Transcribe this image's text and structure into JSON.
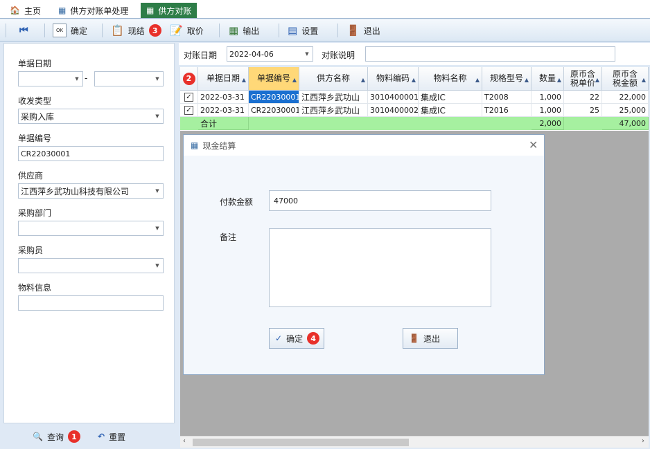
{
  "tabs": [
    {
      "label": "主页"
    },
    {
      "label": "供方对账单处理"
    },
    {
      "label": "供方对账"
    }
  ],
  "toolbar": {
    "confirm": "确定",
    "cash": "现结",
    "cash_badge": "3",
    "cancel_price": "取价",
    "export": "输出",
    "settings": "设置",
    "exit": "退出"
  },
  "left": {
    "doc_date_label": "单据日期",
    "dash": "-",
    "io_type_label": "收发类型",
    "io_type_value": "采购入库",
    "doc_no_label": "单据编号",
    "doc_no_value": "CR22030001",
    "supplier_label": "供应商",
    "supplier_value": "江西萍乡武功山科技有限公司",
    "dept_label": "采购部门",
    "buyer_label": "采购员",
    "material_label": "物料信息",
    "query": "查询",
    "query_badge": "1",
    "reset": "重置"
  },
  "filter": {
    "date_label": "对账日期",
    "date_value": "2022-04-06",
    "desc_label": "对账说明"
  },
  "grid": {
    "badge": "2",
    "headers": [
      "单据日期",
      "单据编号",
      "供方名称",
      "物料编码",
      "物料名称",
      "规格型号",
      "数量",
      "原币含税单价",
      "原币含税金额"
    ],
    "rows": [
      [
        "2022-03-31",
        "CR22030001",
        "江西萍乡武功山",
        "3010400001",
        "集成IC",
        "T2008",
        "1,000",
        "22",
        "22,000"
      ],
      [
        "2022-03-31",
        "CR22030001",
        "江西萍乡武功山",
        "3010400002",
        "集成IC",
        "T2016",
        "1,000",
        "25",
        "25,000"
      ]
    ],
    "total_label": "合计",
    "total_qty": "2,000",
    "total_amount": "47,000"
  },
  "dialog": {
    "title": "现金结算",
    "amount_label": "付款金额",
    "amount_value": "47000",
    "remark_label": "备注",
    "ok": "确定",
    "ok_badge": "4",
    "exit": "退出"
  },
  "colors": {
    "tab_active": "#2e7d48",
    "badge": "#e8302a",
    "total_row": "#a6f0a0",
    "selected_header": "#ffd878"
  }
}
